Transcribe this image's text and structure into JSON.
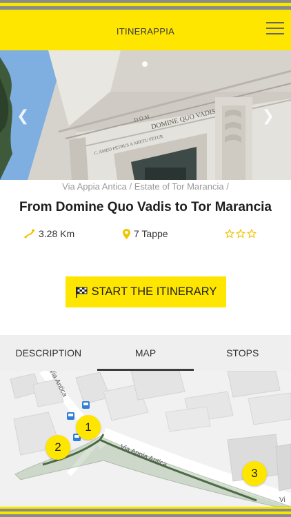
{
  "header": {
    "title": "ITINERAPPIA",
    "menu_icon": "hamburger-menu-icon"
  },
  "hero": {
    "inscription_top": "D O M",
    "inscription_main": "DOMINE QUO VADIS",
    "inscription_left": "C. AMEO PETRUS A ARETU FETUR",
    "slide_count_shown": 1
  },
  "breadcrumb": {
    "items": [
      "Via Appia Antica",
      "Estate of Tor Marancia"
    ],
    "separator": " / "
  },
  "itinerary": {
    "title": "From Domine Quo Vadis to Tor Marancia",
    "distance": "3.28 Km",
    "stages": "7 Tappe",
    "rating": 0,
    "rating_max": 3
  },
  "actions": {
    "start_label": "START THE ITINERARY"
  },
  "tabs": {
    "items": [
      {
        "label": "DESCRIPTION",
        "active": false
      },
      {
        "label": "MAP",
        "active": true
      },
      {
        "label": "STOPS",
        "active": false
      }
    ]
  },
  "map": {
    "street_1": "Via Appia Antica",
    "street_2": "Via Antica",
    "street_3": "Vi",
    "markers": [
      "1",
      "2",
      "3"
    ]
  },
  "colors": {
    "accent": "#ffe600",
    "stripe_grey": "#8a8a8a",
    "route": "#4c6b45"
  }
}
